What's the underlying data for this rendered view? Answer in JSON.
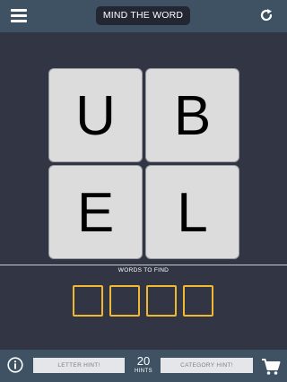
{
  "header": {
    "menu_icon": "hamburger-menu-icon",
    "title": "MIND THE WORD",
    "restart_icon": "restart-icon"
  },
  "tiles": [
    {
      "letter": "U"
    },
    {
      "letter": "B"
    },
    {
      "letter": "E"
    },
    {
      "letter": "L"
    }
  ],
  "answer": {
    "label": "WORDS TO FIND",
    "slots": [
      "",
      "",
      "",
      ""
    ]
  },
  "footer": {
    "info_icon": "info-icon",
    "letter_hint_label": "LETTER HINT!",
    "hints_count": "20",
    "hints_label": "HINTS",
    "category_hint_label": "CATEGORY HINT!",
    "cart_icon": "cart-icon"
  },
  "colors": {
    "background": "#323543",
    "bar": "#3f5264",
    "title_pill": "#232734",
    "tile": "#dcdcdc",
    "slot_border": "#f2b830",
    "hint_button": "#e4e6e9"
  }
}
